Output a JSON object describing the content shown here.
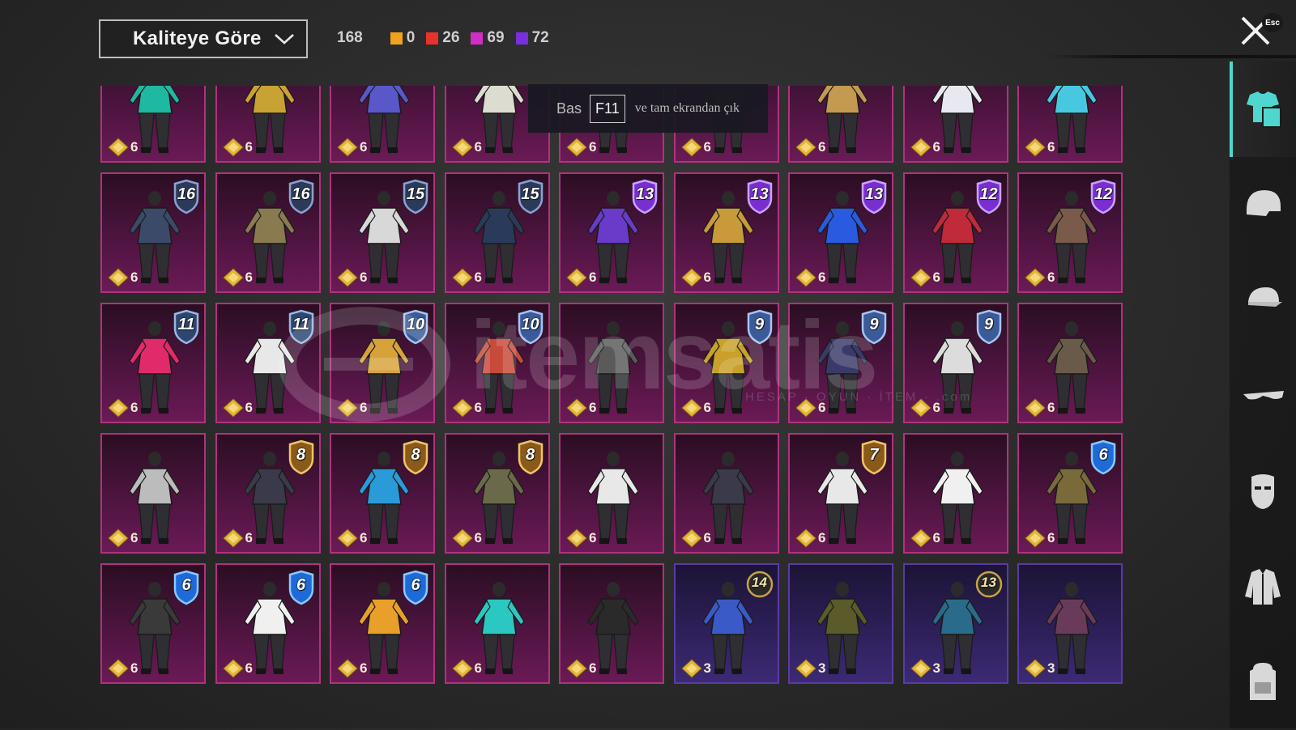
{
  "toolbar": {
    "sort_label": "Kaliteye Göre",
    "total_count": "168",
    "tier_counts": [
      {
        "color": "#f0a21e",
        "value": "0"
      },
      {
        "color": "#e8322c",
        "value": "26"
      },
      {
        "color": "#d02ec4",
        "value": "69"
      },
      {
        "color": "#7a2ee0",
        "value": "72"
      }
    ],
    "close_icon": "close-icon",
    "esc_label": "Esc"
  },
  "tooltip": {
    "prefix": "Bas",
    "key": "F11",
    "message": "ve tam ekrandan çık"
  },
  "watermark": {
    "text": "itemsatis",
    "subtext": "HESAP · OYUN · İTEM · .com"
  },
  "items": [
    {
      "stat": "6",
      "badge": "",
      "tier": "magenta",
      "accent": "#1fb8a0"
    },
    {
      "stat": "6",
      "badge": "",
      "tier": "magenta",
      "accent": "#c9a234"
    },
    {
      "stat": "6",
      "badge": "",
      "tier": "magenta",
      "accent": "#5a58c8"
    },
    {
      "stat": "6",
      "badge": "",
      "tier": "magenta",
      "accent": "#dcdcd0"
    },
    {
      "stat": "6",
      "badge": "",
      "tier": "magenta",
      "accent": "#3c3c3c"
    },
    {
      "stat": "6",
      "badge": "",
      "tier": "magenta",
      "accent": "#3c3c3c"
    },
    {
      "stat": "6",
      "badge": "",
      "tier": "magenta",
      "accent": "#c49a50"
    },
    {
      "stat": "6",
      "badge": "",
      "tier": "magenta",
      "accent": "#e8e8f0"
    },
    {
      "stat": "6",
      "badge": "",
      "tier": "magenta",
      "accent": "#48c8e0"
    },
    {
      "stat": "6",
      "badge": "16",
      "tier": "magenta",
      "accent": "#3c4a6a"
    },
    {
      "stat": "6",
      "badge": "16",
      "tier": "magenta",
      "accent": "#8a7a50"
    },
    {
      "stat": "6",
      "badge": "15",
      "tier": "magenta",
      "accent": "#d8d8d8"
    },
    {
      "stat": "6",
      "badge": "15",
      "tier": "magenta",
      "accent": "#2a3a5a"
    },
    {
      "stat": "6",
      "badge": "13",
      "tier": "magenta",
      "accent": "#6a3ac8"
    },
    {
      "stat": "6",
      "badge": "13",
      "tier": "magenta",
      "accent": "#c89a3a"
    },
    {
      "stat": "6",
      "badge": "13",
      "tier": "magenta",
      "accent": "#2a5ae0"
    },
    {
      "stat": "6",
      "badge": "12",
      "tier": "magenta",
      "accent": "#c02a3a"
    },
    {
      "stat": "6",
      "badge": "12",
      "tier": "magenta",
      "accent": "#7a5a4a"
    },
    {
      "stat": "6",
      "badge": "11",
      "tier": "magenta",
      "accent": "#e02a6a"
    },
    {
      "stat": "6",
      "badge": "11",
      "tier": "magenta",
      "accent": "#e8e8e8"
    },
    {
      "stat": "6",
      "badge": "10",
      "tier": "magenta",
      "accent": "#d8a23a"
    },
    {
      "stat": "6",
      "badge": "10",
      "tier": "magenta",
      "accent": "#c84a3a"
    },
    {
      "stat": "6",
      "badge": "",
      "tier": "magenta",
      "accent": "#5a5a5a"
    },
    {
      "stat": "6",
      "badge": "9",
      "tier": "magenta",
      "accent": "#c8a02a"
    },
    {
      "stat": "6",
      "badge": "9",
      "tier": "magenta",
      "accent": "#3a3a6a"
    },
    {
      "stat": "6",
      "badge": "9",
      "tier": "magenta",
      "accent": "#dcdcdc"
    },
    {
      "stat": "6",
      "badge": "",
      "tier": "magenta",
      "accent": "#6a5a4a"
    },
    {
      "stat": "6",
      "badge": "",
      "tier": "magenta",
      "accent": "#bcbcbc"
    },
    {
      "stat": "6",
      "badge": "8",
      "tier": "magenta",
      "accent": "#3a3a4a"
    },
    {
      "stat": "6",
      "badge": "8",
      "tier": "magenta",
      "accent": "#2a9ad8"
    },
    {
      "stat": "6",
      "badge": "8",
      "tier": "magenta",
      "accent": "#6a6a4a"
    },
    {
      "stat": "6",
      "badge": "",
      "tier": "magenta",
      "accent": "#e8e8e8"
    },
    {
      "stat": "6",
      "badge": "",
      "tier": "magenta",
      "accent": "#3a3a4a"
    },
    {
      "stat": "6",
      "badge": "7",
      "tier": "magenta",
      "accent": "#e8e8e8"
    },
    {
      "stat": "6",
      "badge": "",
      "tier": "magenta",
      "accent": "#f0f0f0"
    },
    {
      "stat": "6",
      "badge": "6",
      "tier": "magenta",
      "accent": "#7a6a3a"
    },
    {
      "stat": "6",
      "badge": "6",
      "tier": "magenta",
      "accent": "#3a3a3a"
    },
    {
      "stat": "6",
      "badge": "6",
      "tier": "magenta",
      "accent": "#f0f0f0"
    },
    {
      "stat": "6",
      "badge": "6",
      "tier": "magenta",
      "accent": "#e8a02a"
    },
    {
      "stat": "6",
      "badge": "",
      "tier": "magenta",
      "accent": "#2ac8c0"
    },
    {
      "stat": "6",
      "badge": "",
      "tier": "magenta",
      "accent": "#2a2a2a"
    },
    {
      "stat": "3",
      "badge": "14",
      "tier": "purple",
      "accent": "#3a5ac8"
    },
    {
      "stat": "3",
      "badge": "",
      "tier": "purple",
      "accent": "#5a5a2a"
    },
    {
      "stat": "3",
      "badge": "13",
      "tier": "purple",
      "accent": "#2a6a8a"
    },
    {
      "stat": "3",
      "badge": "",
      "tier": "purple",
      "accent": "#6a3a5a"
    }
  ],
  "sidebar": [
    {
      "name": "outfit-icon",
      "active": true
    },
    {
      "name": "helmet-icon",
      "active": false
    },
    {
      "name": "cap-icon",
      "active": false
    },
    {
      "name": "glasses-icon",
      "active": false
    },
    {
      "name": "mask-icon",
      "active": false
    },
    {
      "name": "jacket-icon",
      "active": false
    },
    {
      "name": "backpack-icon",
      "active": false
    }
  ]
}
